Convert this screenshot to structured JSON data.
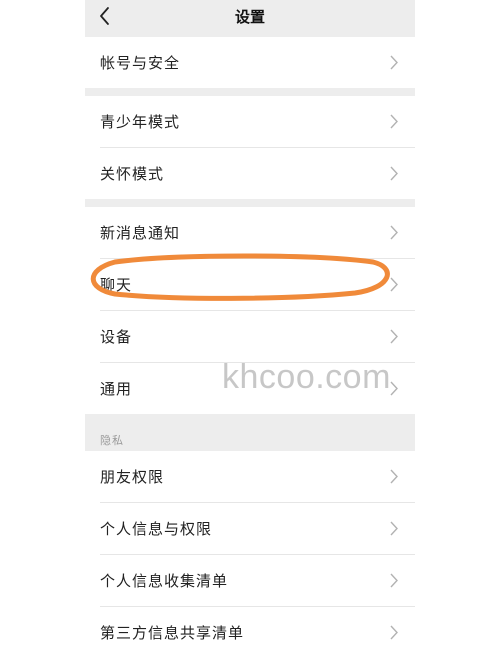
{
  "header": {
    "title": "设置",
    "back_icon": "chevron-left-icon"
  },
  "groups": [
    {
      "items": [
        {
          "label": "帐号与安全"
        }
      ]
    },
    {
      "items": [
        {
          "label": "青少年模式"
        },
        {
          "label": "关怀模式"
        }
      ]
    },
    {
      "items": [
        {
          "label": "新消息通知"
        },
        {
          "label": "聊天"
        },
        {
          "label": "设备"
        },
        {
          "label": "通用"
        }
      ]
    },
    {
      "title": "隐私",
      "items": [
        {
          "label": "朋友权限"
        },
        {
          "label": "个人信息与权限"
        },
        {
          "label": "个人信息收集清单"
        },
        {
          "label": "第三方信息共享清单"
        }
      ]
    }
  ],
  "watermark": "khcoo.com",
  "colors": {
    "highlight": "#f08a3a",
    "gap": "#ededed",
    "chevron": "#b2b2b2"
  }
}
